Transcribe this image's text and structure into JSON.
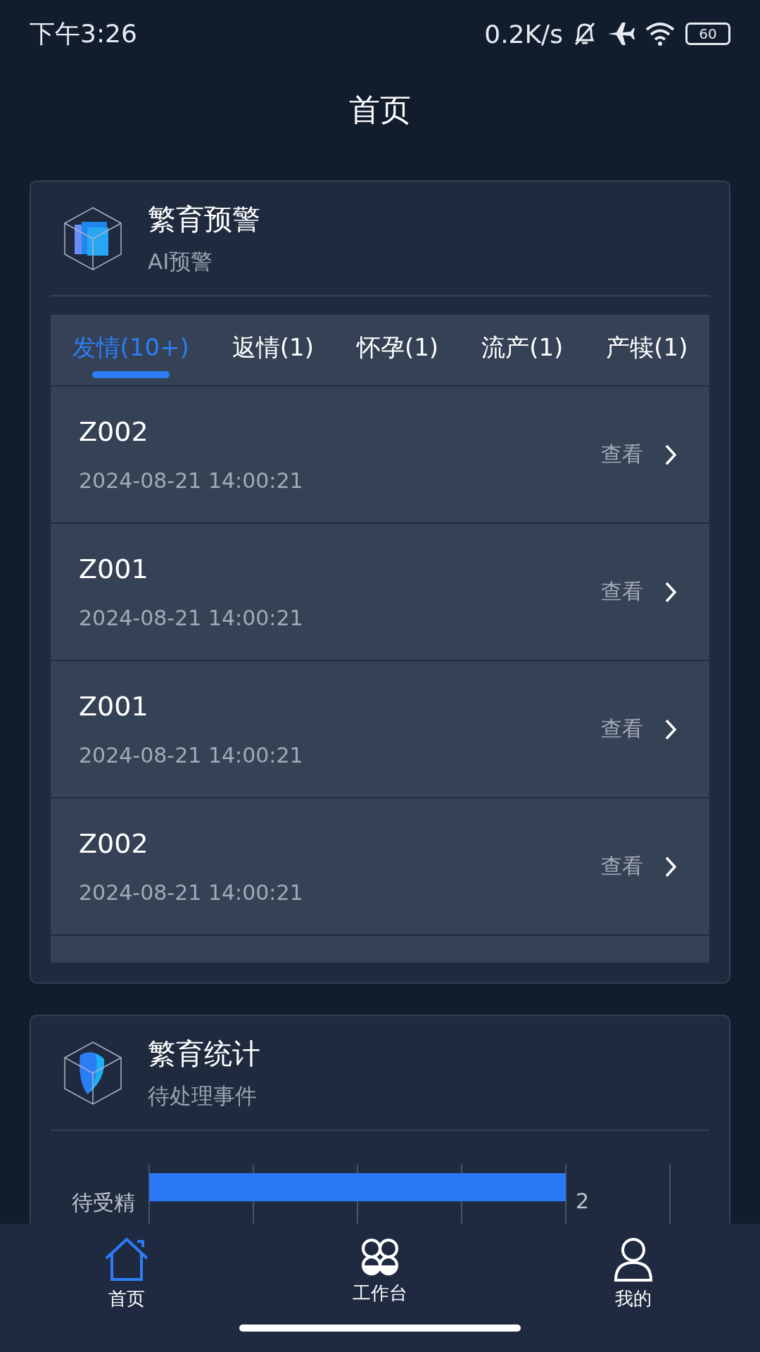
{
  "status_bar": {
    "time": "下午3:26",
    "speed": "0.2K/s",
    "battery": "60"
  },
  "header": {
    "title": "首页"
  },
  "warning_card": {
    "title": "繁育预警",
    "subtitle": "AI预警",
    "tabs": [
      {
        "label": "发情(10+)",
        "selected": true
      },
      {
        "label": "返情(1)",
        "selected": false
      },
      {
        "label": "怀孕(1)",
        "selected": false
      },
      {
        "label": "流产(1)",
        "selected": false
      },
      {
        "label": "产犊(1)",
        "selected": false
      }
    ],
    "rows": [
      {
        "id": "Z002",
        "time": "2024-08-21 14:00:21",
        "action": "查看"
      },
      {
        "id": "Z001",
        "time": "2024-08-21 14:00:21",
        "action": "查看"
      },
      {
        "id": "Z001",
        "time": "2024-08-21 14:00:21",
        "action": "查看"
      },
      {
        "id": "Z002",
        "time": "2024-08-21 14:00:21",
        "action": "查看"
      }
    ]
  },
  "stats_card": {
    "title": "繁育统计",
    "subtitle": "待处理事件",
    "chart_data": {
      "type": "bar",
      "orientation": "horizontal",
      "categories": [
        "待受精"
      ],
      "values": [
        2
      ],
      "data_labels": true
    }
  },
  "bottom_nav": [
    {
      "label": "首页",
      "kind": "home",
      "selected": true
    },
    {
      "label": "工作台",
      "kind": "workbench",
      "selected": false
    },
    {
      "label": "我的",
      "kind": "profile",
      "selected": false
    }
  ]
}
